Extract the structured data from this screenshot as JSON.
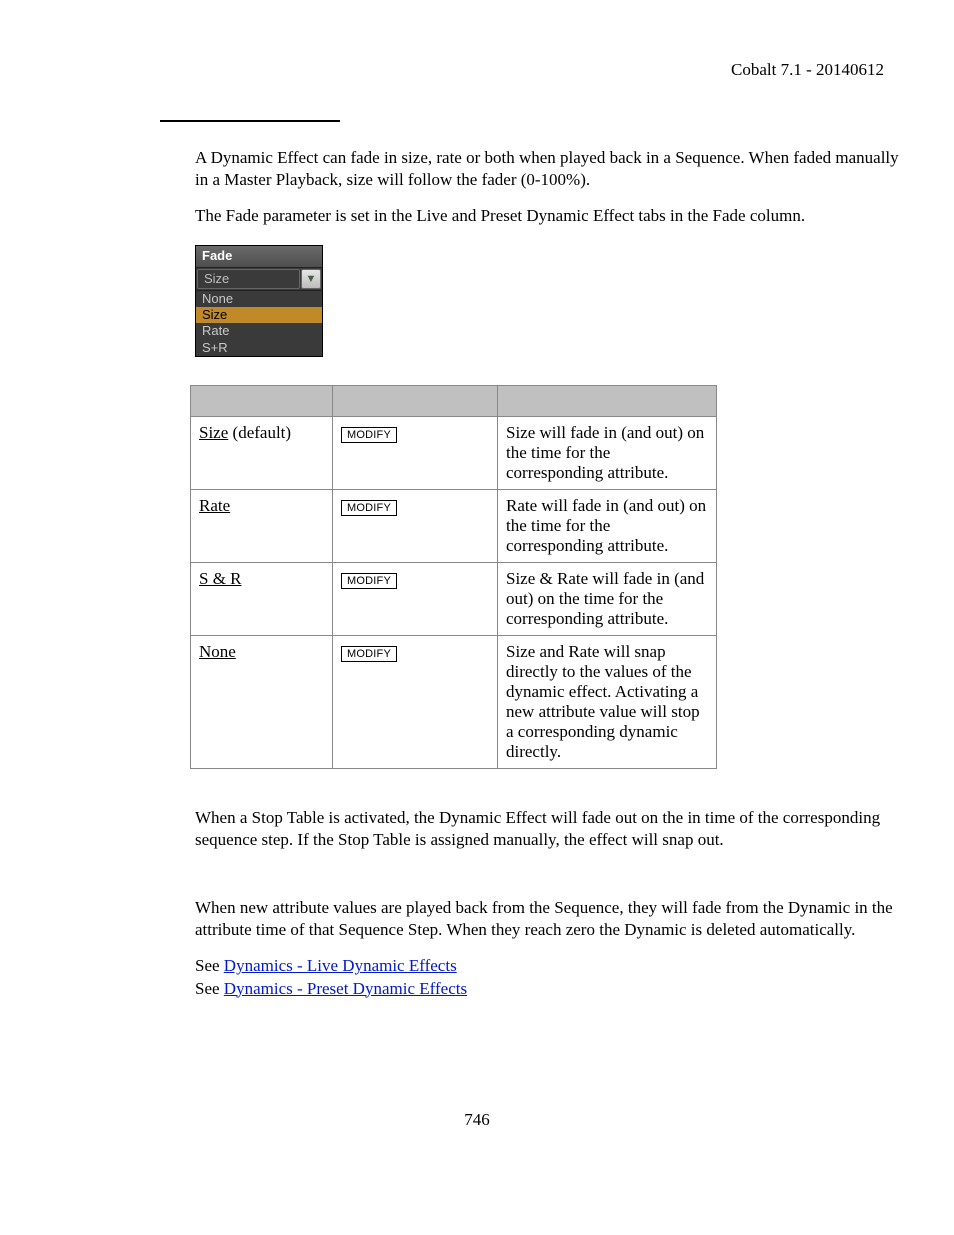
{
  "header": {
    "right": "Cobalt 7.1 - 20140612"
  },
  "intro": {
    "p1": "A Dynamic Effect can fade in size, rate or both when played back in a Sequence. When faded manually in a Master Playback, size will follow the fader (0-100%).",
    "p2": "The Fade parameter is set in the Live and Preset Dynamic Effect tabs in the Fade column."
  },
  "fadeWidget": {
    "title": "Fade",
    "selectValue": "Size",
    "options": [
      "None",
      "Size",
      "Rate",
      "S+R"
    ],
    "selectedIndex": 1
  },
  "table": {
    "modifyLabel": "MODIFY",
    "rows": [
      {
        "name": "Size",
        "suffix": " (default)",
        "desc": "Size will fade in (and out) on the time for the corresponding attribute."
      },
      {
        "name": "Rate",
        "suffix": "",
        "desc": "Rate will fade in (and out) on the time for the corresponding attribute."
      },
      {
        "name": "S & R",
        "suffix": "",
        "desc": "Size & Rate will fade in (and out) on the time for the corresponding attribute."
      },
      {
        "name": "None",
        "suffix": "",
        "desc": "Size and Rate will snap directly to the values of the dynamic effect. Activating a new attribute value will stop a corresponding dynamic directly."
      }
    ]
  },
  "post": {
    "p3": "When a Stop Table is activated, the Dynamic Effect will fade out on the in time of the corresponding sequence step. If the Stop Table is assigned manually, the effect will snap out.",
    "p4": "When new attribute values are played back from the Sequence, they will fade from the Dynamic in the attribute time of that Sequence Step. When they reach zero the Dynamic is deleted automatically.",
    "seePrefix": "See ",
    "link1": "Dynamics - Live Dynamic Effects",
    "link2": "Dynamics - Preset Dynamic Effects"
  },
  "pageNum": "746"
}
